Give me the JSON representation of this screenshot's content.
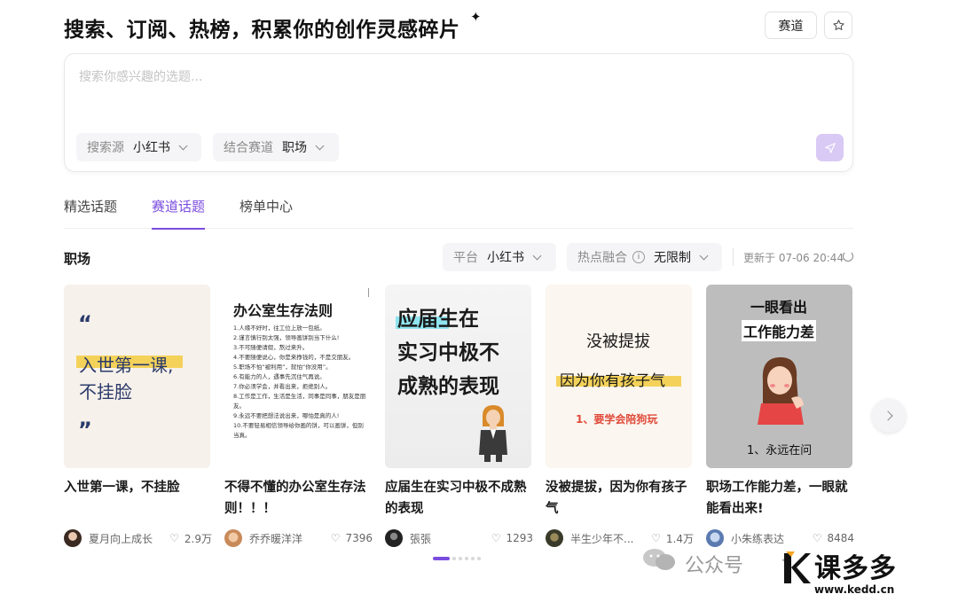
{
  "header": {
    "title": "搜索、订阅、热榜，积累你的创作灵感碎片",
    "sparkle": "✦",
    "track_button": "赛道",
    "star_icon": "star-icon"
  },
  "search": {
    "placeholder": "搜索你感兴趣的选题...",
    "source_label": "搜索源",
    "source_value": "小红书",
    "track_label": "结合赛道",
    "track_value": "职场",
    "send_icon": "send-icon"
  },
  "tabs": [
    {
      "label": "精选话题",
      "active": false
    },
    {
      "label": "赛道话题",
      "active": true
    },
    {
      "label": "榜单中心",
      "active": false
    }
  ],
  "section": {
    "title": "职场",
    "platform_label": "平台",
    "platform_value": "小红书",
    "hot_label": "热点融合",
    "hot_value": "无限制",
    "updated": "更新于 07-06 20:44"
  },
  "cards": [
    {
      "title": "入世第一课，不挂脸",
      "author": "夏月向上成长",
      "likes": "2.9万",
      "thumb": {
        "quote_open": "“",
        "line1": "入世第一课,",
        "line2": "不挂脸",
        "quote_close": "”"
      }
    },
    {
      "title": "不得不懂的办公室生存法则！！！",
      "author": "乔乔暖洋洋",
      "likes": "7396",
      "thumb": {
        "heading": "办公室生存法则",
        "lines": [
          "1.人缘不好时，往工位上放一包纸。",
          "2.谨言慎行别太强，领导画饼别当下什么!",
          "3.不可随便请假，熬过来升。",
          "4.不要随便说心，你是来挣钱的，不是交朋友。",
          "5.职场不怕“被利用”，就怕“你没用”。",
          "6.有能力的人，遇事先沉住气再说。",
          "7.你必须学会，并看出来，拒绝别人。",
          "8.工作是工作，生活是生活，同事是同事，朋友是朋友。",
          "9.永远不要把想法说出来，哪怕是真的人!",
          "10.不要轻易相信领导给你画的饼，可以画饼，但别当真。"
        ]
      }
    },
    {
      "title": "应届生在实习中极不成熟的表现",
      "author": "張張",
      "likes": "1293",
      "thumb": {
        "line1": "应届生在",
        "line2": "实习中极不",
        "line3": "成熟的表现"
      }
    },
    {
      "title": "没被提拔，因为你有孩子气",
      "author": "半生少年不...",
      "likes": "1.4万",
      "thumb": {
        "line1": "没被提拔",
        "line2": "因为你有孩子气",
        "line3": "1、要学会陪狗玩"
      }
    },
    {
      "title": "职场工作能力差，一眼就能看出来!",
      "author": "小朱练表达",
      "likes": "8484",
      "thumb": {
        "line1": "一眼看出",
        "line2": "工作能力差",
        "line3": "1、永远在问"
      }
    }
  ],
  "watermark": {
    "wechat": "公众号",
    "dot": "·",
    "brand": "课多多",
    "url": "www.kedd.cn"
  },
  "colors": {
    "accent": "#7b4ce0",
    "send_bg": "#d9c9f5",
    "chip_bg": "#f5f5f7"
  }
}
